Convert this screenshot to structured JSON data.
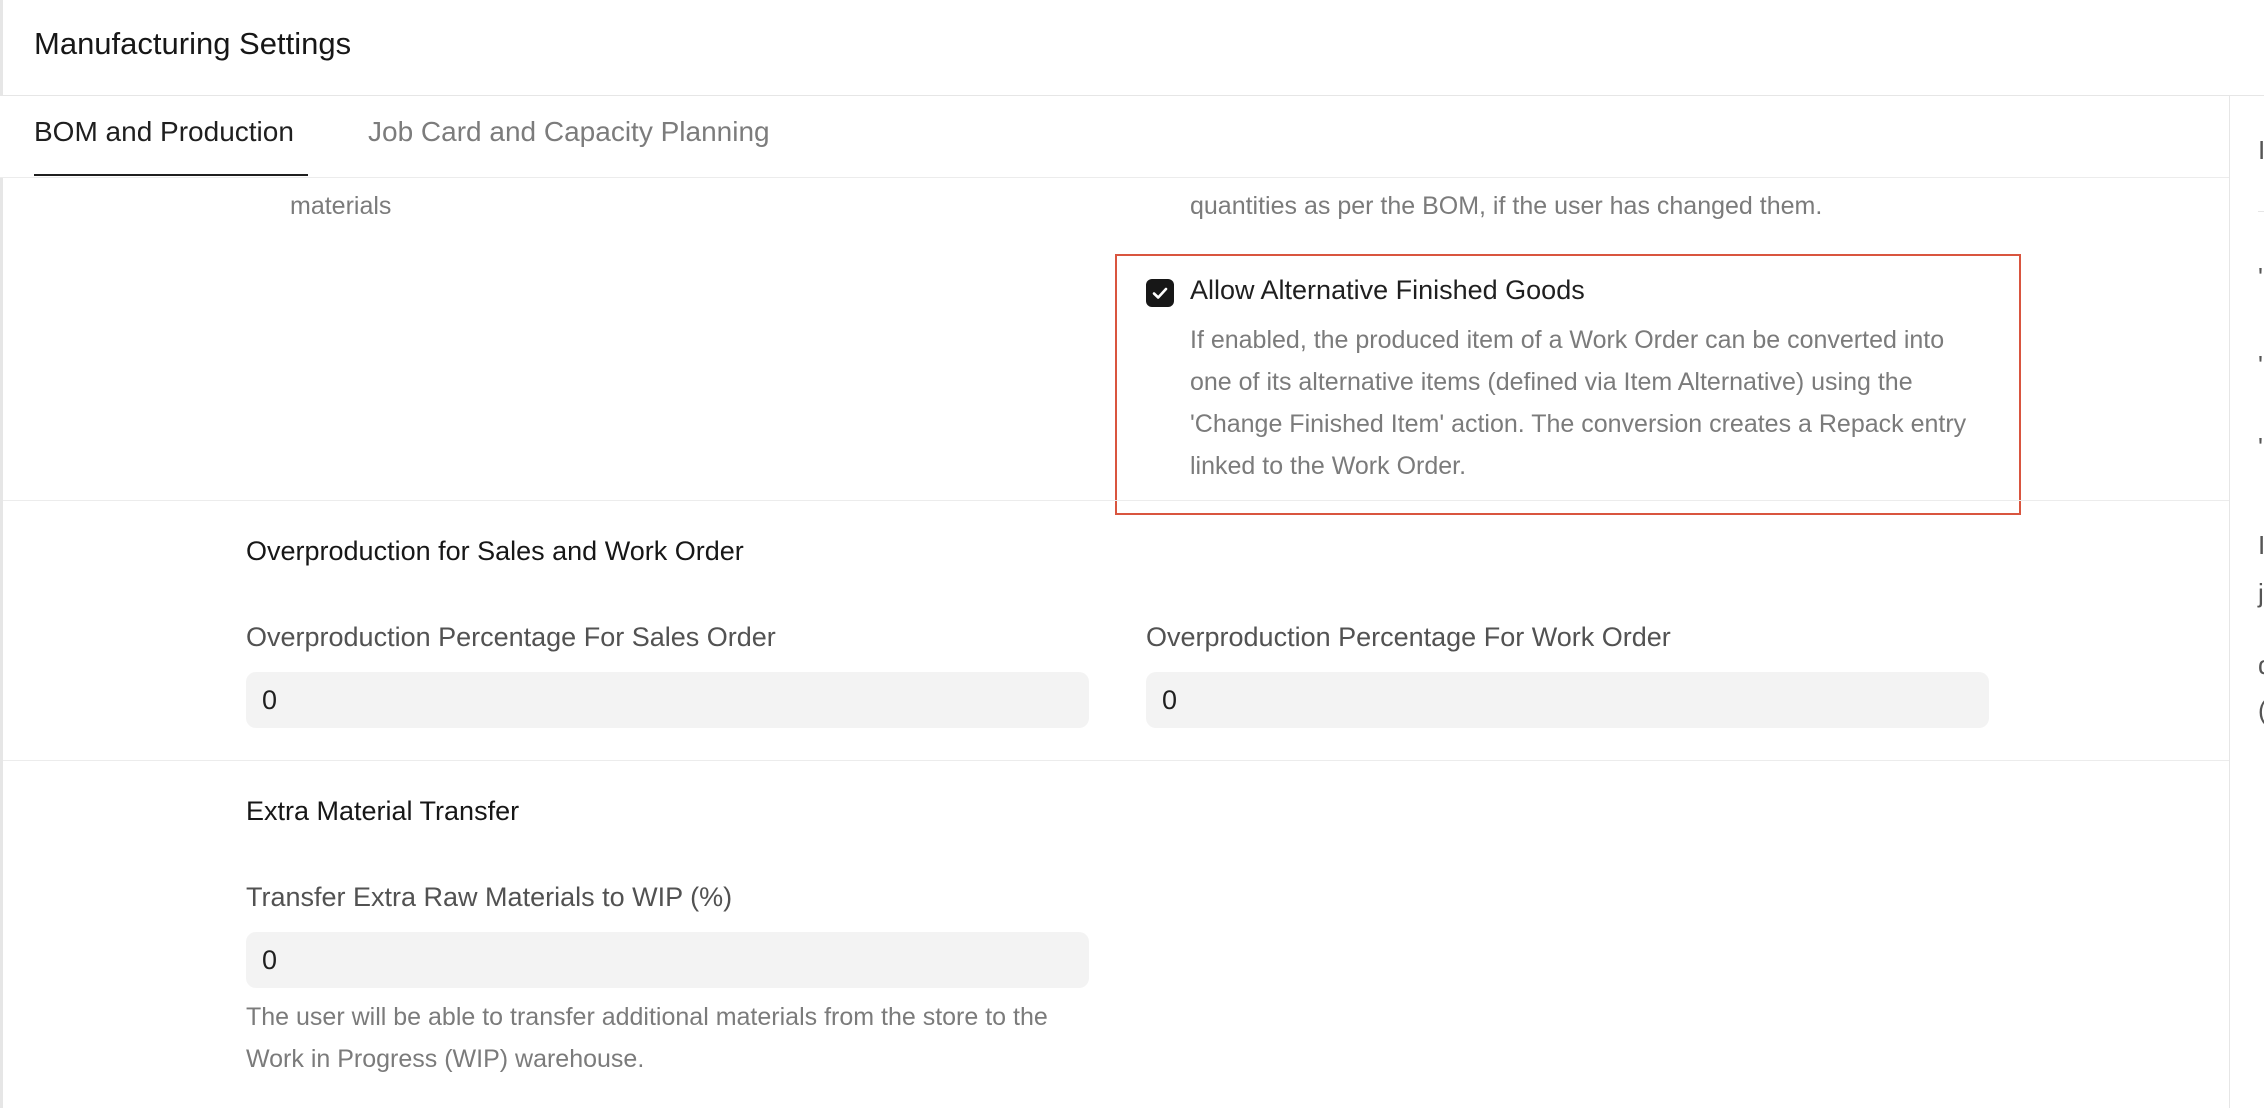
{
  "page": {
    "title": "Manufacturing Settings"
  },
  "tabs": [
    {
      "label": "BOM and Production",
      "active": true
    },
    {
      "label": "Job Card and Capacity Planning",
      "active": false
    }
  ],
  "clipped_top": {
    "left_help": "latest Valuation Rate/Price List Rate/Last Purchase Rate of raw materials",
    "right_help": "and their quantities in the Work Order. The system will not reset the quantities as per the BOM, if the user has changed them."
  },
  "alt_finished_goods": {
    "label": "Allow Alternative Finished Goods",
    "checked": true,
    "help": "If enabled, the produced item of a Work Order can be converted into one of its alternative items (defined via Item Alternative) using the 'Change Finished Item' action. The conversion creates a Repack entry linked to the Work Order."
  },
  "overproduction": {
    "title": "Overproduction for Sales and Work Order",
    "sales_label": "Overproduction Percentage For Sales Order",
    "sales_value": "0",
    "work_label": "Overproduction Percentage For Work Order",
    "work_value": "0"
  },
  "extra_material": {
    "title": "Extra Material Transfer",
    "label": "Transfer Extra Raw Materials to WIP (%)",
    "value": "0",
    "help": "The user will be able to transfer additional materials from the store to the Work in Progress (WIP) warehouse."
  },
  "right_rail_fragments": [
    "I",
    "'",
    "'",
    "'",
    "I",
    "j",
    "d",
    "("
  ],
  "colors": {
    "highlight": "#d9553f",
    "checkbox": "#171717",
    "input_bg": "#f3f3f3"
  }
}
